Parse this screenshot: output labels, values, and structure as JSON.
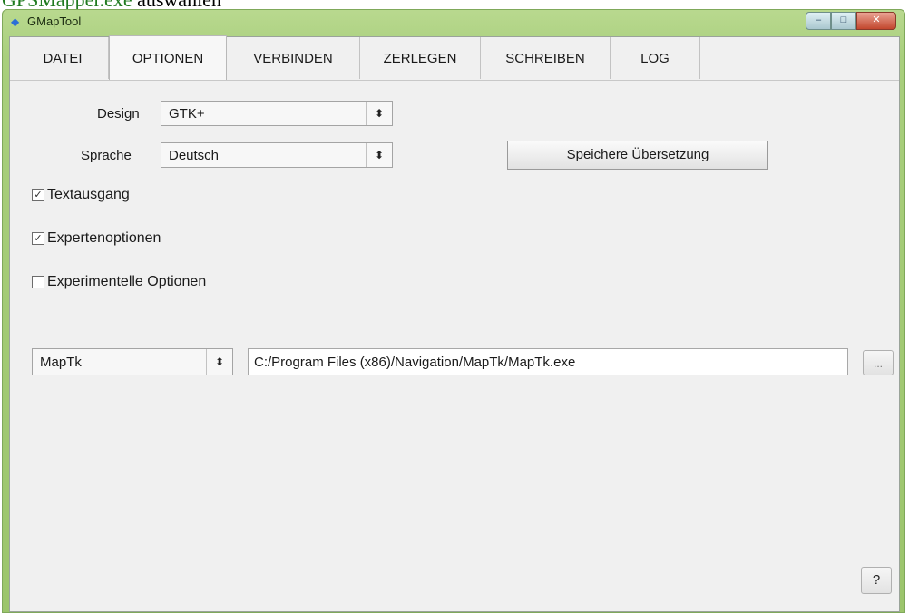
{
  "caption": {
    "link": "GPSMapper.exe",
    "text": "auswählen"
  },
  "window": {
    "title": "GMapTool",
    "controls": {
      "minimize": "–",
      "maximize": "□",
      "close": "✕"
    }
  },
  "tabs": [
    "DATEI",
    "OPTIONEN",
    "VERBINDEN",
    "ZERLEGEN",
    "SCHREIBEN",
    "LOG"
  ],
  "design": {
    "label": "Design",
    "value": "GTK+"
  },
  "language": {
    "label": "Sprache",
    "value": "Deutsch"
  },
  "save_translation_button": "Speichere Übersetzung",
  "checkboxes": {
    "text_output": {
      "label": "Textausgang",
      "checked": true
    },
    "expert_options": {
      "label": "Expertenoptionen",
      "checked": true
    },
    "experimental_options": {
      "label": "Experimentelle Optionen",
      "checked": false
    }
  },
  "tool": {
    "selected": "MapTk",
    "path": "C:/Program Files (x86)/Navigation/MapTk/MapTk.exe",
    "browse_label": "..."
  },
  "help_button": "?",
  "colors": {
    "frame": "#9cc56c",
    "client": "#f0f0f0",
    "caption_link": "#1f7a1f"
  }
}
